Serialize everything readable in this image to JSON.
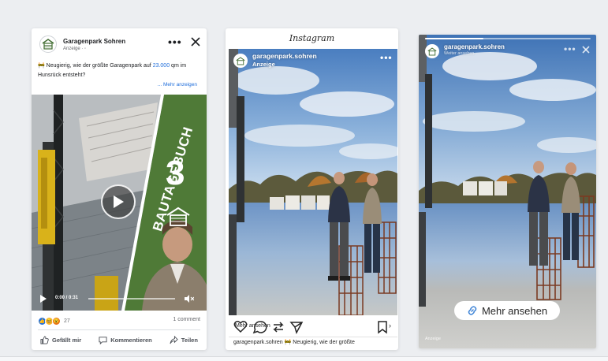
{
  "colors": {
    "fb_blue": "#216fdb",
    "green_panel": "#4f7a37",
    "page_background": "#eceef1"
  },
  "facebook": {
    "page_name": "Garagenpark Sohren",
    "sponsored": "Anzeige ·",
    "more_icon": "more-horizontal-icon",
    "close_icon": "close-icon",
    "post_text_pre": "🚧 Neugierig, wie der größte Garagenpark auf ",
    "post_text_num": "23.000",
    "post_text_post": " qm im Hunsrück entsteht?",
    "see_more": "... Mehr anzeigen",
    "overlay_title": "BAUTAGEBUCH",
    "overlay_number": "3",
    "video_time": "0:00 / 0:31",
    "reaction_count": "27",
    "comment_count": "1 comment",
    "actions": {
      "like": "Gefällt mir",
      "comment": "Kommentieren",
      "share": "Teilen"
    }
  },
  "instagram": {
    "logo": "Instagram",
    "username": "garagenpark.sohren",
    "sponsored": "Anzeige",
    "cta": "Mehr ansehen",
    "caption_user": "garagenpark.sohren",
    "caption_text": " 🚧 Neugierig, wie der größte"
  },
  "story": {
    "username": "garagenpark.sohren",
    "sub": "Weiter ansehen",
    "progress": 0.35,
    "cta": "Mehr ansehen",
    "footer": "Anzeige"
  }
}
